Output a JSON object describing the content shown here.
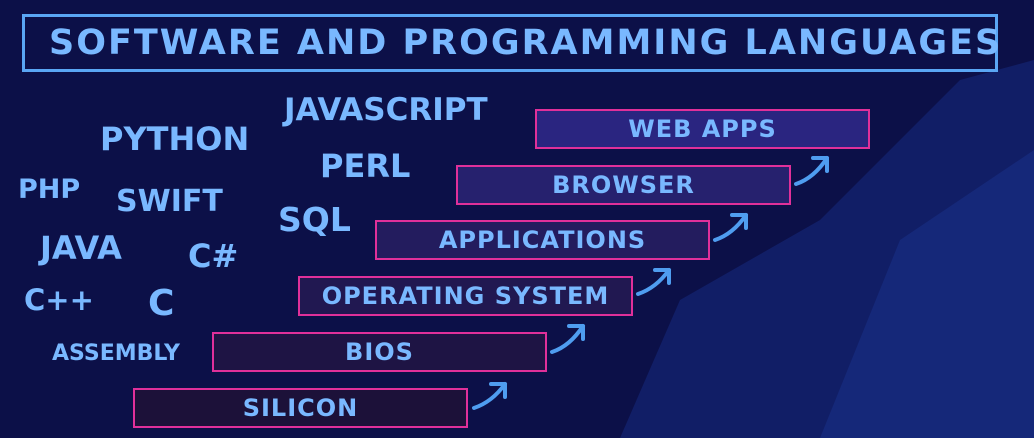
{
  "title": "SOFTWARE AND PROGRAMMING LANGUAGES",
  "languages": [
    "JAVASCRIPT",
    "PYTHON",
    "PERL",
    "PHP",
    "SWIFT",
    "SQL",
    "JAVA",
    "C#",
    "C++",
    "C",
    "ASSEMBLY"
  ],
  "layers": [
    "WEB APPS",
    "BROWSER",
    "APPLICATIONS",
    "OPERATING SYSTEM",
    "BIOS",
    "SILICON"
  ],
  "colors": {
    "background": "#0c1048",
    "text": "#79b8ff",
    "title_border": "#5aa6f4",
    "layer_border": "#e0309a",
    "arrow": "#4f9df0"
  }
}
